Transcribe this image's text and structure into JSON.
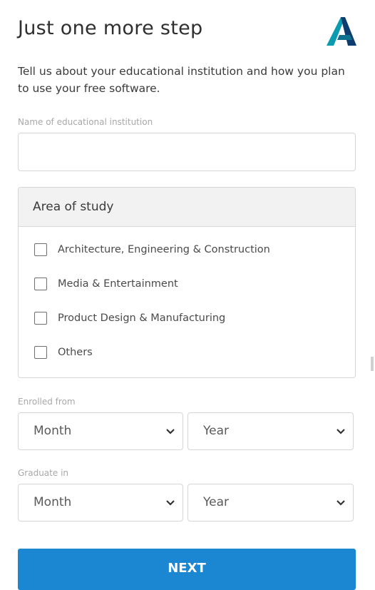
{
  "header": {
    "title": "Just one more step"
  },
  "intro": {
    "text": "Tell us about your educational institution and how you plan to use your free software."
  },
  "institution": {
    "label": "Name of educational institution",
    "value": ""
  },
  "study": {
    "heading": "Area of study",
    "options": [
      {
        "label": "Architecture, Engineering & Construction",
        "checked": false
      },
      {
        "label": "Media & Entertainment",
        "checked": false
      },
      {
        "label": "Product Design & Manufacturing",
        "checked": false
      },
      {
        "label": "Others",
        "checked": false
      }
    ]
  },
  "enrolled": {
    "label": "Enrolled from",
    "month": "Month",
    "year": "Year"
  },
  "graduate": {
    "label": "Graduate in",
    "month": "Month",
    "year": "Year"
  },
  "next_button": {
    "label": "NEXT"
  },
  "colors": {
    "primary_button": "#1b86d1",
    "logo_teal": "#0a9bb0",
    "logo_dark": "#0d3d6e"
  },
  "icons": {
    "logo": "autodesk-logo-icon",
    "select_caret": "chevron-down-icon"
  }
}
